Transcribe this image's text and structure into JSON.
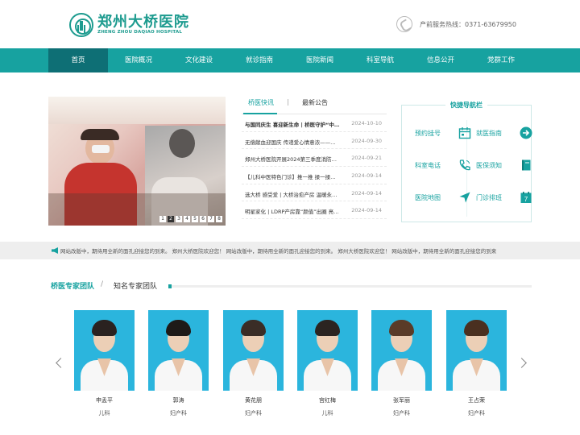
{
  "header": {
    "logo_cn": "郑州大桥医院",
    "logo_en": "ZHENG ZHOU DAQIAO HOSPITAL",
    "hotline": "产前服务热线：0371-63679950"
  },
  "nav": {
    "items": [
      "首页",
      "医院概况",
      "文化建设",
      "就诊指南",
      "医院新闻",
      "科室导航",
      "信息公开",
      "党群工作"
    ]
  },
  "banner": {
    "pages": [
      "1",
      "2",
      "3",
      "4",
      "5",
      "6",
      "7",
      "8"
    ],
    "active_page": "2"
  },
  "news": {
    "tabs": [
      "桥医快讯",
      "最新公告"
    ],
    "separator": "|",
    "items": [
      {
        "title": "与国同庆生 喜迎新生命 | 桥医守护“中…",
        "date": "2024-10-10"
      },
      {
        "title": "无偿献血迎国庆 传递爱心情意浓——…",
        "date": "2024-09-30"
      },
      {
        "title": "郑州大桥医院开展2024第三季度消防…",
        "date": "2024-09-21"
      },
      {
        "title": "【儿科中医特色门诊】推一推 揉一揉…",
        "date": "2024-09-14"
      },
      {
        "title": "选大桥 感受爱 | 大桥治愈产房 温暖永…",
        "date": "2024-09-14"
      },
      {
        "title": "明星家化 | LDRP产房靠“颜值”出圈 亮…",
        "date": "2024-09-14"
      }
    ]
  },
  "quick_nav": {
    "title": "快捷导航栏",
    "items": [
      {
        "label": "预约挂号",
        "icon": "calendar-icon"
      },
      {
        "label": "就医指南",
        "icon": "arrow-circle-icon"
      },
      {
        "label": "科室电话",
        "icon": "phone-icon"
      },
      {
        "label": "医保须知",
        "icon": "book-icon"
      },
      {
        "label": "医院地图",
        "icon": "location-arrow-icon"
      },
      {
        "label": "门诊排班",
        "icon": "calendar-7-icon"
      }
    ],
    "calendar_day": "7"
  },
  "ticker": {
    "text": "网站改版中，期待用全新的面孔迎接您的到来。 郑州大桥医院欢迎您！ 网站改版中，期待用全新的面孔迎接您的到来。 郑州大桥医院欢迎您！ 网站改版中，期待用全新的面孔迎接您的到来"
  },
  "team": {
    "title": "桥医专家团队",
    "separator": "/",
    "subtitle": "知名专家团队",
    "doctors": [
      {
        "name": "申孟平",
        "dept": "儿科",
        "hair": "#2a2220"
      },
      {
        "name": "郭涛",
        "dept": "妇产科",
        "hair": "#1e1a18"
      },
      {
        "name": "黄花朋",
        "dept": "妇产科",
        "hair": "#3a2d26"
      },
      {
        "name": "宫红梅",
        "dept": "儿科",
        "hair": "#2b2421"
      },
      {
        "name": "张军丽",
        "dept": "妇产科",
        "hair": "#5a3b28"
      },
      {
        "name": "王占荣",
        "dept": "妇产科",
        "hair": "#4a3020"
      }
    ]
  },
  "colors": {
    "brand": "#17a2a0",
    "nav_active": "#0e6f75",
    "photo_bg": "#2bb5dd"
  }
}
